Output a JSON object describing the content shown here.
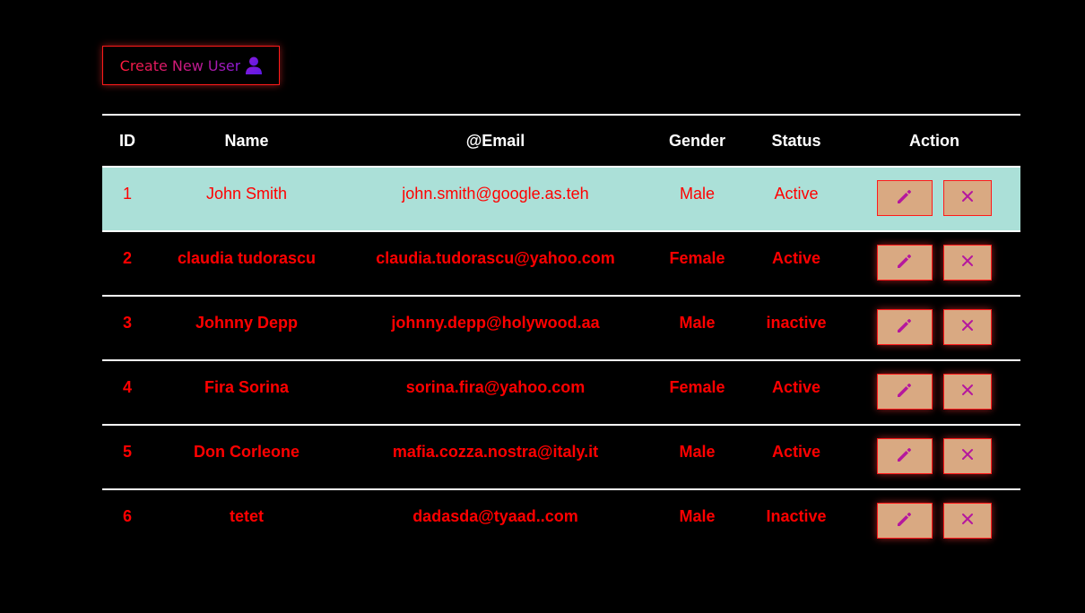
{
  "create_button": {
    "label": "Create New User",
    "icon": "user-icon"
  },
  "table": {
    "headers": {
      "id": "ID",
      "name": "Name",
      "email": "@Email",
      "gender": "Gender",
      "status": "Status",
      "action": "Action"
    },
    "rows": [
      {
        "id": "1",
        "name": "John Smith",
        "email": "john.smith@google.as.teh",
        "gender": "Male",
        "status": "Active"
      },
      {
        "id": "2",
        "name": "claudia tudorascu",
        "email": "claudia.tudorascu@yahoo.com",
        "gender": "Female",
        "status": "Active"
      },
      {
        "id": "3",
        "name": "Johnny Depp",
        "email": "johnny.depp@holywood.aa",
        "gender": "Male",
        "status": "inactive"
      },
      {
        "id": "4",
        "name": "Fira Sorina",
        "email": "sorina.fira@yahoo.com",
        "gender": "Female",
        "status": "Active"
      },
      {
        "id": "5",
        "name": "Don Corleone",
        "email": "mafia.cozza.nostra@italy.it",
        "gender": "Male",
        "status": "Active"
      },
      {
        "id": "6",
        "name": "tetet",
        "email": "dadasda@tyaad..com",
        "gender": "Male",
        "status": "Inactive"
      }
    ]
  },
  "icons": {
    "edit": "pencil-icon",
    "delete": "close-icon"
  },
  "colors": {
    "background": "#000000",
    "text_accent": "#ff0000",
    "header_text": "#ffffff",
    "highlight_row": "#abe0d8",
    "action_button_bg": "#d9a982",
    "icon_color": "#b5179e"
  }
}
